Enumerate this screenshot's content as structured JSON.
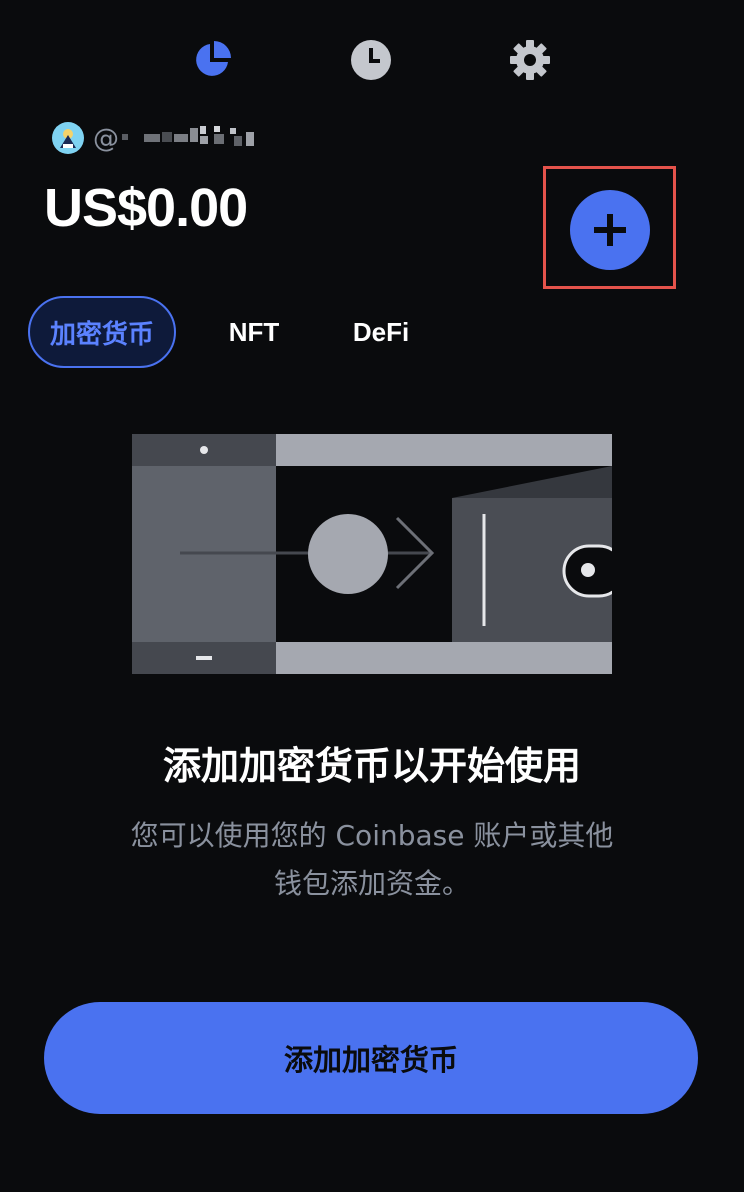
{
  "nav": {
    "icons": [
      "portfolio-pie-icon",
      "history-clock-icon",
      "settings-gear-icon"
    ],
    "active_color": "#4a72f0",
    "inactive_color": "#c4c7cd"
  },
  "account": {
    "handle_prefix": "@",
    "balance": "US$0.00"
  },
  "actions": {
    "add_icon": "plus-icon"
  },
  "tabs": [
    {
      "label": "加密货币",
      "active": true
    },
    {
      "label": "NFT",
      "active": false
    },
    {
      "label": "DeFi",
      "active": false
    }
  ],
  "empty_state": {
    "title": "添加加密货币以开始使用",
    "description_line1": "您可以使用您的 Coinbase 账户或其他",
    "description_line2": "钱包添加资金。"
  },
  "cta": {
    "label": "添加加密货币"
  },
  "colors": {
    "background": "#0a0b0d",
    "accent": "#4a72f0",
    "highlight": "#e5534b",
    "muted_text": "#8a919e"
  }
}
